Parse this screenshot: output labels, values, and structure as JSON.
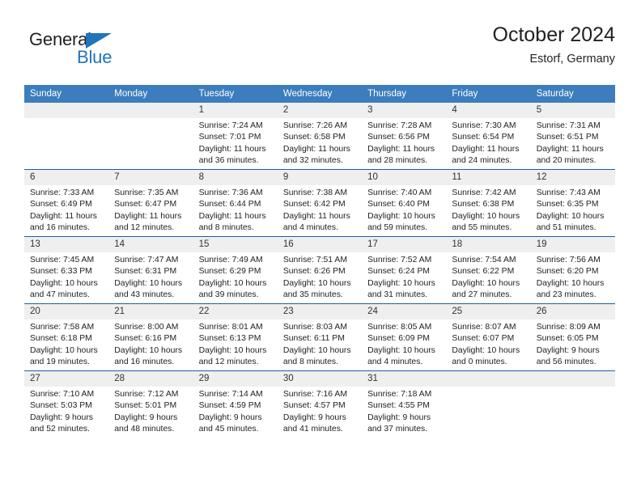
{
  "logo": {
    "word_one": "General",
    "word_two": "Blue",
    "triangle_icon": "blue-triangle-icon",
    "brand_color": "#1f74bb",
    "text_color": "#231f20"
  },
  "header": {
    "title": "October 2024",
    "subtitle": "Estorf, Germany"
  },
  "colors": {
    "header_blue": "#3b7dbd",
    "row_divider": "#1f5fa0",
    "daynum_band": "#efefef",
    "text": "#222222"
  },
  "weekdays": [
    "Sunday",
    "Monday",
    "Tuesday",
    "Wednesday",
    "Thursday",
    "Friday",
    "Saturday"
  ],
  "labels": {
    "sunrise_prefix": "Sunrise:",
    "sunset_prefix": "Sunset:",
    "daylight_prefix": "Daylight:"
  },
  "weeks": [
    [
      {
        "day": "",
        "sunrise": "",
        "sunset": "",
        "daylight_a": "",
        "daylight_b": ""
      },
      {
        "day": "",
        "sunrise": "",
        "sunset": "",
        "daylight_a": "",
        "daylight_b": ""
      },
      {
        "day": "1",
        "sunrise": "Sunrise: 7:24 AM",
        "sunset": "Sunset: 7:01 PM",
        "daylight_a": "Daylight: 11 hours",
        "daylight_b": "and 36 minutes."
      },
      {
        "day": "2",
        "sunrise": "Sunrise: 7:26 AM",
        "sunset": "Sunset: 6:58 PM",
        "daylight_a": "Daylight: 11 hours",
        "daylight_b": "and 32 minutes."
      },
      {
        "day": "3",
        "sunrise": "Sunrise: 7:28 AM",
        "sunset": "Sunset: 6:56 PM",
        "daylight_a": "Daylight: 11 hours",
        "daylight_b": "and 28 minutes."
      },
      {
        "day": "4",
        "sunrise": "Sunrise: 7:30 AM",
        "sunset": "Sunset: 6:54 PM",
        "daylight_a": "Daylight: 11 hours",
        "daylight_b": "and 24 minutes."
      },
      {
        "day": "5",
        "sunrise": "Sunrise: 7:31 AM",
        "sunset": "Sunset: 6:51 PM",
        "daylight_a": "Daylight: 11 hours",
        "daylight_b": "and 20 minutes."
      }
    ],
    [
      {
        "day": "6",
        "sunrise": "Sunrise: 7:33 AM",
        "sunset": "Sunset: 6:49 PM",
        "daylight_a": "Daylight: 11 hours",
        "daylight_b": "and 16 minutes."
      },
      {
        "day": "7",
        "sunrise": "Sunrise: 7:35 AM",
        "sunset": "Sunset: 6:47 PM",
        "daylight_a": "Daylight: 11 hours",
        "daylight_b": "and 12 minutes."
      },
      {
        "day": "8",
        "sunrise": "Sunrise: 7:36 AM",
        "sunset": "Sunset: 6:44 PM",
        "daylight_a": "Daylight: 11 hours",
        "daylight_b": "and 8 minutes."
      },
      {
        "day": "9",
        "sunrise": "Sunrise: 7:38 AM",
        "sunset": "Sunset: 6:42 PM",
        "daylight_a": "Daylight: 11 hours",
        "daylight_b": "and 4 minutes."
      },
      {
        "day": "10",
        "sunrise": "Sunrise: 7:40 AM",
        "sunset": "Sunset: 6:40 PM",
        "daylight_a": "Daylight: 10 hours",
        "daylight_b": "and 59 minutes."
      },
      {
        "day": "11",
        "sunrise": "Sunrise: 7:42 AM",
        "sunset": "Sunset: 6:38 PM",
        "daylight_a": "Daylight: 10 hours",
        "daylight_b": "and 55 minutes."
      },
      {
        "day": "12",
        "sunrise": "Sunrise: 7:43 AM",
        "sunset": "Sunset: 6:35 PM",
        "daylight_a": "Daylight: 10 hours",
        "daylight_b": "and 51 minutes."
      }
    ],
    [
      {
        "day": "13",
        "sunrise": "Sunrise: 7:45 AM",
        "sunset": "Sunset: 6:33 PM",
        "daylight_a": "Daylight: 10 hours",
        "daylight_b": "and 47 minutes."
      },
      {
        "day": "14",
        "sunrise": "Sunrise: 7:47 AM",
        "sunset": "Sunset: 6:31 PM",
        "daylight_a": "Daylight: 10 hours",
        "daylight_b": "and 43 minutes."
      },
      {
        "day": "15",
        "sunrise": "Sunrise: 7:49 AM",
        "sunset": "Sunset: 6:29 PM",
        "daylight_a": "Daylight: 10 hours",
        "daylight_b": "and 39 minutes."
      },
      {
        "day": "16",
        "sunrise": "Sunrise: 7:51 AM",
        "sunset": "Sunset: 6:26 PM",
        "daylight_a": "Daylight: 10 hours",
        "daylight_b": "and 35 minutes."
      },
      {
        "day": "17",
        "sunrise": "Sunrise: 7:52 AM",
        "sunset": "Sunset: 6:24 PM",
        "daylight_a": "Daylight: 10 hours",
        "daylight_b": "and 31 minutes."
      },
      {
        "day": "18",
        "sunrise": "Sunrise: 7:54 AM",
        "sunset": "Sunset: 6:22 PM",
        "daylight_a": "Daylight: 10 hours",
        "daylight_b": "and 27 minutes."
      },
      {
        "day": "19",
        "sunrise": "Sunrise: 7:56 AM",
        "sunset": "Sunset: 6:20 PM",
        "daylight_a": "Daylight: 10 hours",
        "daylight_b": "and 23 minutes."
      }
    ],
    [
      {
        "day": "20",
        "sunrise": "Sunrise: 7:58 AM",
        "sunset": "Sunset: 6:18 PM",
        "daylight_a": "Daylight: 10 hours",
        "daylight_b": "and 19 minutes."
      },
      {
        "day": "21",
        "sunrise": "Sunrise: 8:00 AM",
        "sunset": "Sunset: 6:16 PM",
        "daylight_a": "Daylight: 10 hours",
        "daylight_b": "and 16 minutes."
      },
      {
        "day": "22",
        "sunrise": "Sunrise: 8:01 AM",
        "sunset": "Sunset: 6:13 PM",
        "daylight_a": "Daylight: 10 hours",
        "daylight_b": "and 12 minutes."
      },
      {
        "day": "23",
        "sunrise": "Sunrise: 8:03 AM",
        "sunset": "Sunset: 6:11 PM",
        "daylight_a": "Daylight: 10 hours",
        "daylight_b": "and 8 minutes."
      },
      {
        "day": "24",
        "sunrise": "Sunrise: 8:05 AM",
        "sunset": "Sunset: 6:09 PM",
        "daylight_a": "Daylight: 10 hours",
        "daylight_b": "and 4 minutes."
      },
      {
        "day": "25",
        "sunrise": "Sunrise: 8:07 AM",
        "sunset": "Sunset: 6:07 PM",
        "daylight_a": "Daylight: 10 hours",
        "daylight_b": "and 0 minutes."
      },
      {
        "day": "26",
        "sunrise": "Sunrise: 8:09 AM",
        "sunset": "Sunset: 6:05 PM",
        "daylight_a": "Daylight: 9 hours",
        "daylight_b": "and 56 minutes."
      }
    ],
    [
      {
        "day": "27",
        "sunrise": "Sunrise: 7:10 AM",
        "sunset": "Sunset: 5:03 PM",
        "daylight_a": "Daylight: 9 hours",
        "daylight_b": "and 52 minutes."
      },
      {
        "day": "28",
        "sunrise": "Sunrise: 7:12 AM",
        "sunset": "Sunset: 5:01 PM",
        "daylight_a": "Daylight: 9 hours",
        "daylight_b": "and 48 minutes."
      },
      {
        "day": "29",
        "sunrise": "Sunrise: 7:14 AM",
        "sunset": "Sunset: 4:59 PM",
        "daylight_a": "Daylight: 9 hours",
        "daylight_b": "and 45 minutes."
      },
      {
        "day": "30",
        "sunrise": "Sunrise: 7:16 AM",
        "sunset": "Sunset: 4:57 PM",
        "daylight_a": "Daylight: 9 hours",
        "daylight_b": "and 41 minutes."
      },
      {
        "day": "31",
        "sunrise": "Sunrise: 7:18 AM",
        "sunset": "Sunset: 4:55 PM",
        "daylight_a": "Daylight: 9 hours",
        "daylight_b": "and 37 minutes."
      },
      {
        "day": "",
        "sunrise": "",
        "sunset": "",
        "daylight_a": "",
        "daylight_b": ""
      },
      {
        "day": "",
        "sunrise": "",
        "sunset": "",
        "daylight_a": "",
        "daylight_b": ""
      }
    ]
  ]
}
